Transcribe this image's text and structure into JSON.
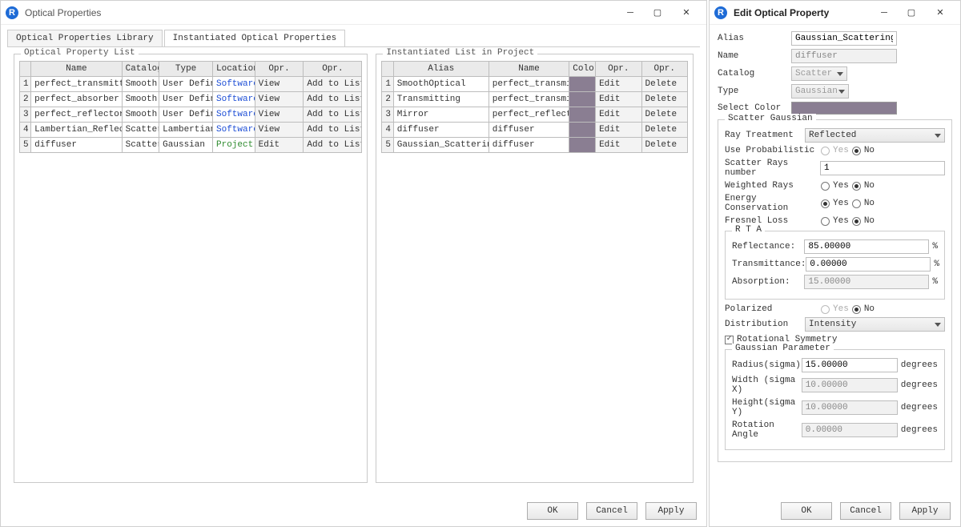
{
  "left_window": {
    "title": "Optical Properties",
    "tabs": {
      "library": "Optical Properties Library",
      "instantiated": "Instantiated Optical Properties"
    },
    "library_panel": {
      "legend": "Optical Property List",
      "headers": [
        "Name",
        "Catalog",
        "Type",
        "Location",
        "Opr.",
        "Opr."
      ],
      "rows": [
        {
          "num": "1",
          "name": "perfect_transmitter",
          "catalog": "Smooth",
          "type": "User Defined",
          "location": "Software",
          "opr1": "View",
          "opr2": "Add to List"
        },
        {
          "num": "2",
          "name": "perfect_absorber",
          "catalog": "Smooth",
          "type": "User Defined",
          "location": "Software",
          "opr1": "View",
          "opr2": "Add to List"
        },
        {
          "num": "3",
          "name": "perfect_reflector",
          "catalog": "Smooth",
          "type": "User Defined",
          "location": "Software",
          "opr1": "View",
          "opr2": "Add to List"
        },
        {
          "num": "4",
          "name": "Lambertian_Reflector",
          "catalog": "Scatter",
          "type": "Lambertian",
          "location": "Software",
          "opr1": "View",
          "opr2": "Add to List"
        },
        {
          "num": "5",
          "name": "diffuser",
          "catalog": "Scatter",
          "type": "Gaussian",
          "location": "Project",
          "opr1": "Edit",
          "opr2": "Add to List"
        }
      ]
    },
    "instance_panel": {
      "legend": "Instantiated List in Project",
      "headers": [
        "Alias",
        "Name",
        "Color",
        "Opr.",
        "Opr."
      ],
      "rows": [
        {
          "num": "1",
          "alias": "SmoothOptical",
          "name": "perfect_transmitter",
          "opr1": "Edit",
          "opr2": "Delete"
        },
        {
          "num": "2",
          "alias": "Transmitting",
          "name": "perfect_transmitter",
          "opr1": "Edit",
          "opr2": "Delete"
        },
        {
          "num": "3",
          "alias": "Mirror",
          "name": "perfect_reflector",
          "opr1": "Edit",
          "opr2": "Delete"
        },
        {
          "num": "4",
          "alias": "diffuser",
          "name": "diffuser",
          "opr1": "Edit",
          "opr2": "Delete"
        },
        {
          "num": "5",
          "alias": "Gaussian_Scattering",
          "name": "diffuser",
          "opr1": "Edit",
          "opr2": "Delete"
        }
      ]
    },
    "btns": {
      "ok": "OK",
      "cancel": "Cancel",
      "apply": "Apply"
    }
  },
  "right_window": {
    "title": "Edit Optical Property",
    "labels": {
      "alias": "Alias",
      "name": "Name",
      "catalog": "Catalog",
      "type": "Type",
      "select_color": "Select Color",
      "scatter_group": "Scatter Gaussian",
      "ray_treatment": "Ray Treatment",
      "use_prob": "Use Probabilistic",
      "scatter_rays_num": "Scatter Rays number",
      "weighted_rays": "Weighted Rays",
      "energy_cons": "Energy Conservation",
      "fresnel_loss": "Fresnel Loss",
      "rta_group": "R T A",
      "reflectance": "Reflectance:",
      "transmittance": "Transmittance:",
      "absorption": "Absorption:",
      "polarized": "Polarized",
      "distribution": "Distribution",
      "rot_sym": "Rotational Symmetry",
      "gauss_group": "Gaussian Parameter",
      "radius": "Radius(sigma)",
      "width": "Width (sigma X)",
      "height": "Height(sigma Y)",
      "rot_angle": "Rotation Angle",
      "yes": "Yes",
      "no": "No",
      "pct": "%",
      "deg": "degrees"
    },
    "values": {
      "alias": "Gaussian_Scattering",
      "name": "diffuser",
      "catalog": "Scatter",
      "type": "Gaussian",
      "ray_treatment": "Reflected",
      "scatter_rays": "1",
      "reflectance": "85.00000",
      "transmittance": "0.00000",
      "absorption": "15.00000",
      "distribution": "Intensity",
      "radius": "15.00000",
      "width": "10.00000",
      "height": "10.00000",
      "rot_angle": "0.00000"
    },
    "btns": {
      "ok": "OK",
      "cancel": "Cancel",
      "apply": "Apply"
    }
  }
}
